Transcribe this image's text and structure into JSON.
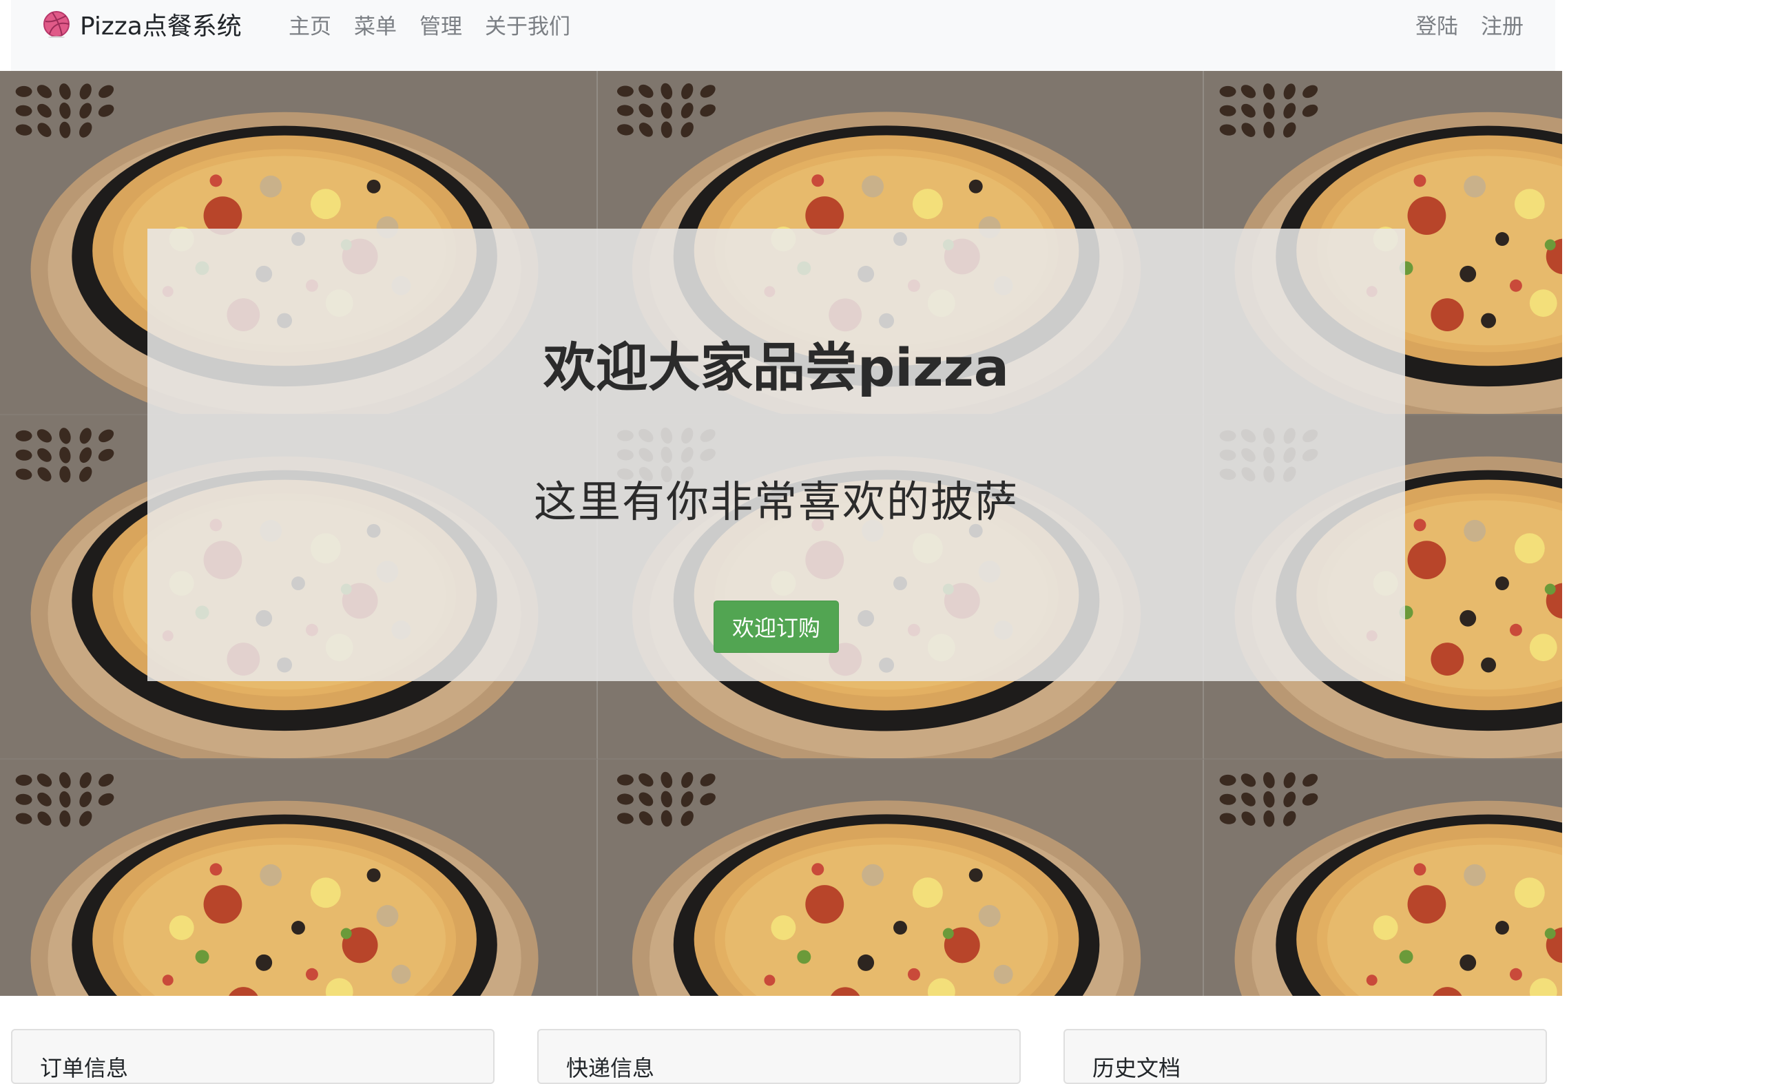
{
  "navbar": {
    "brand": "Pizza点餐系统",
    "links": [
      {
        "label": "主页"
      },
      {
        "label": "菜单"
      },
      {
        "label": "管理"
      },
      {
        "label": "关于我们"
      }
    ],
    "right_links": [
      {
        "label": "登陆"
      },
      {
        "label": "注册"
      }
    ]
  },
  "hero": {
    "title": "欢迎大家品尝pizza",
    "subtitle": "这里有你非常喜欢的披萨",
    "button_label": "欢迎订购"
  },
  "cards": [
    {
      "header": "订单信息"
    },
    {
      "header": "快递信息"
    },
    {
      "header": "历史文档"
    }
  ],
  "colors": {
    "navbar_bg": "#f8f9fa",
    "button_green": "#52a552",
    "overlay": "#e9e9e9"
  }
}
